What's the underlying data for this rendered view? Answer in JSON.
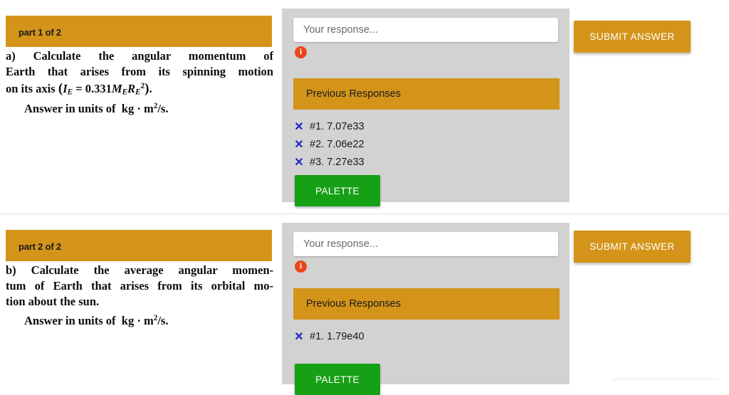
{
  "sections": [
    {
      "part_label": "part 1 of 2",
      "question": {
        "lead": "a)",
        "lines": [
          "a)  Calculate  the  angular  momentum  of",
          "Earth  that  arises  from  its  spinning  motion",
          "on its axis"
        ],
        "formula_text": "(I_E = 0.331 M_E R_E^2).",
        "formula_parts": {
          "open_paren": "(",
          "var1": "I",
          "var1_sub": "E",
          "equals": "=",
          "coefficient": "0.331",
          "var2": "M",
          "var2_sub": "E",
          "var3": "R",
          "var3_sub": "E",
          "var3_sup": "2",
          "close_paren": ")",
          "period": "."
        },
        "answer_line_prefix": "Answer in units of",
        "answer_units": {
          "kg": "kg",
          "dot": "·",
          "m": "m",
          "exponent": "2",
          "per_s": "/s."
        }
      },
      "response": {
        "input_placeholder": "Your response...",
        "input_value": "",
        "info_icon": "info-icon",
        "info_glyph": "i",
        "previous_header": "Previous Responses",
        "previous_items": [
          {
            "mark": "x-mark-icon",
            "glyph": "✕",
            "label": "#1. 7.07e33"
          },
          {
            "mark": "x-mark-icon",
            "glyph": "✕",
            "label": "#2. 7.06e22"
          },
          {
            "mark": "x-mark-icon",
            "glyph": "✕",
            "label": "#3. 7.27e33"
          }
        ],
        "palette_label": "PALETTE",
        "submit_label": "SUBMIT ANSWER"
      }
    },
    {
      "part_label": "part 2 of 2",
      "question": {
        "lead": "b)",
        "lines": [
          "b)  Calculate  the  average  angular  momen-",
          "tum of Earth that arises from its orbital mo-",
          "tion about the sun."
        ],
        "formula_text": "",
        "answer_line_prefix": "Answer in units of",
        "answer_units": {
          "kg": "kg",
          "dot": "·",
          "m": "m",
          "exponent": "2",
          "per_s": "/s."
        }
      },
      "response": {
        "input_placeholder": "Your response...",
        "input_value": "",
        "info_icon": "info-icon",
        "info_glyph": "i",
        "previous_header": "Previous Responses",
        "previous_items": [
          {
            "mark": "x-mark-icon",
            "glyph": "✕",
            "label": "#1. 1.79e40"
          }
        ],
        "palette_label": "PALETTE",
        "submit_label": "SUBMIT ANSWER"
      }
    }
  ],
  "colors": {
    "header_orange": "#d4941a",
    "panel_gray": "#d2d2d2",
    "palette_green": "#16a016",
    "info_red": "#e8471c",
    "x_mark_blue": "#2222cc",
    "page_white": "#ffffff"
  }
}
